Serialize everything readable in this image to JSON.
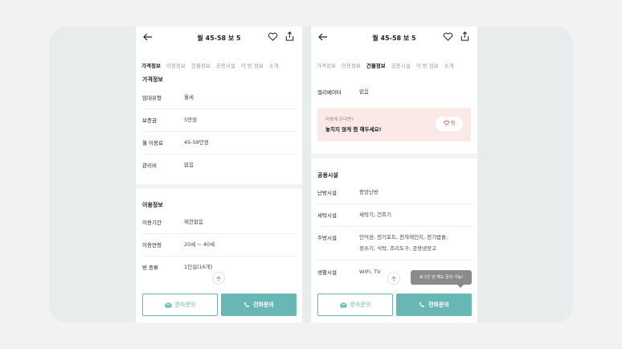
{
  "listing": {
    "title": "월 45-58  보 5"
  },
  "tabs": [
    "가격정보",
    "이용정보",
    "건물정보",
    "공용시설",
    "각 방 정보",
    "소개"
  ],
  "left": {
    "section_price": "가격정보",
    "price_rows": [
      {
        "key": "임대유형",
        "value": "월세"
      },
      {
        "key": "보증금",
        "value": "5만원"
      },
      {
        "key": "월 이용료",
        "value": "45-58만원"
      },
      {
        "key": "관리비",
        "value": "없음"
      }
    ],
    "section_usage": "이용정보",
    "usage_rows": [
      {
        "key": "이용기간",
        "value": "제한없음"
      },
      {
        "key": "이용연령",
        "value": "20세 ~ 40세"
      },
      {
        "key": "방 종류",
        "value": "1인실(16개)"
      }
    ]
  },
  "right": {
    "elevator": {
      "key": "엘리베이터",
      "value": "없음"
    },
    "promo": {
      "sub": "마음에 든다면?",
      "main": "놓치지 않게 찜 해두세요!",
      "button": "찜"
    },
    "section_facilities": "공용시설",
    "facility_rows": [
      {
        "key": "난방시설",
        "value": "중앙난방"
      },
      {
        "key": "세탁시설",
        "value": "세탁기, 건조기"
      },
      {
        "key": "주방시설",
        "value": "인덕션, 전기포트, 전자레인지, 전기밥솥,",
        "value2": "정수기, 식탁, 조리도구, 공용냉장고"
      },
      {
        "key": "생활시설",
        "value": "WIFI, TV"
      }
    ],
    "tooltip": "로그인 안 해도 문의 가능!"
  },
  "buttons": {
    "message": "문자문의",
    "call": "전화문의"
  },
  "colors": {
    "accent": "#69b7b5",
    "promo_bg": "#fbe9e7",
    "heart": "#e35a55"
  }
}
